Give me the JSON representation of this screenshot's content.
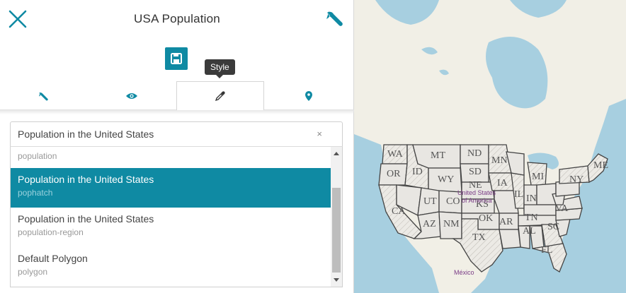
{
  "header": {
    "title": "USA Population"
  },
  "toolbar": {
    "tooltip": "Style"
  },
  "style_select": {
    "selected_value": "Population in the United States",
    "clear_symbol": "×",
    "options": [
      {
        "name": "",
        "sub": "population"
      },
      {
        "name": "Population in the United States",
        "sub": "pophatch",
        "selected": true
      },
      {
        "name": "Population in the United States",
        "sub": "population-region"
      },
      {
        "name": "Default Polygon",
        "sub": "polygon"
      }
    ]
  },
  "map": {
    "states": [
      "WA",
      "MT",
      "ND",
      "MN",
      "ME",
      "OR",
      "ID",
      "SD",
      "MI",
      "NY",
      "WY",
      "NE",
      "IA",
      "UT",
      "CO",
      "KS",
      "IL",
      "CA",
      "AZ",
      "NM",
      "OK",
      "AR",
      "TN",
      "VA",
      "TX",
      "AL",
      "SC",
      "FL",
      "IN"
    ],
    "labels": {
      "country_line1": "United States",
      "country_line2": "of America",
      "mexico": "México"
    },
    "colors": {
      "water": "#a7cfe0",
      "land": "#f1efe6",
      "states_fill": "#e8e6e2",
      "states_stroke": "#444444",
      "accent": "#0f8aa3"
    }
  }
}
